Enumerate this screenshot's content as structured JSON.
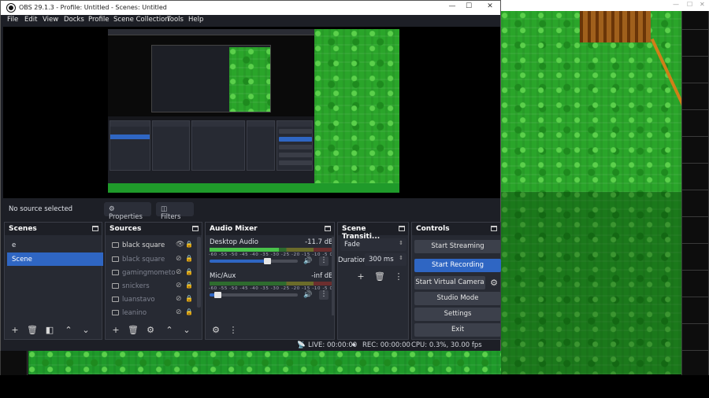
{
  "window": {
    "title": "OBS 29.1.3 - Profile: Untitled - Scenes: Untitled",
    "minimize": "—",
    "maximize": "☐",
    "close": "✕"
  },
  "menu": [
    "File",
    "Edit",
    "View",
    "Docks",
    "Profile",
    "Scene Collection",
    "Tools",
    "Help"
  ],
  "source_bar": {
    "status": "No source selected",
    "properties_label": "Properties",
    "filters_label": "Filters"
  },
  "scenes": {
    "title": "Scenes",
    "items": [
      {
        "label": "e",
        "active": false
      },
      {
        "label": "Scene",
        "active": true
      }
    ]
  },
  "sources": {
    "title": "Sources",
    "items": [
      {
        "label": "black square",
        "visible": true
      },
      {
        "label": "black square",
        "visible": false
      },
      {
        "label": "gamingmometo",
        "visible": false
      },
      {
        "label": "snickers",
        "visible": false
      },
      {
        "label": "luanstavo",
        "visible": false
      },
      {
        "label": "leanino",
        "visible": false
      }
    ]
  },
  "audio_mixer": {
    "title": "Audio Mixer",
    "ticks": "-60 -55 -50 -45 -40 -35 -30 -25 -20 -15 -10 -5 0",
    "channels": [
      {
        "name": "Desktop Audio",
        "db": "-11.7 dB",
        "volume": 0.66
      },
      {
        "name": "Mic/Aux",
        "db": "-inf dB",
        "volume": 0.09
      }
    ]
  },
  "transitions": {
    "title": "Scene Transiti...",
    "selected": "Fade",
    "duration_label": "Duration",
    "duration_value": "300 ms"
  },
  "controls": {
    "title": "Controls",
    "buttons": [
      "Start Streaming",
      "Start Recording",
      "Start Virtual Camera",
      "Studio Mode",
      "Settings",
      "Exit"
    ]
  },
  "status": {
    "live": "LIVE: 00:00:00",
    "rec": "REC: 00:00:00",
    "cpu": "CPU: 0.3%, 30.00 fps"
  },
  "colors": {
    "accent": "#2f66c3",
    "panel": "#272a33",
    "background": "#1d1f26"
  }
}
